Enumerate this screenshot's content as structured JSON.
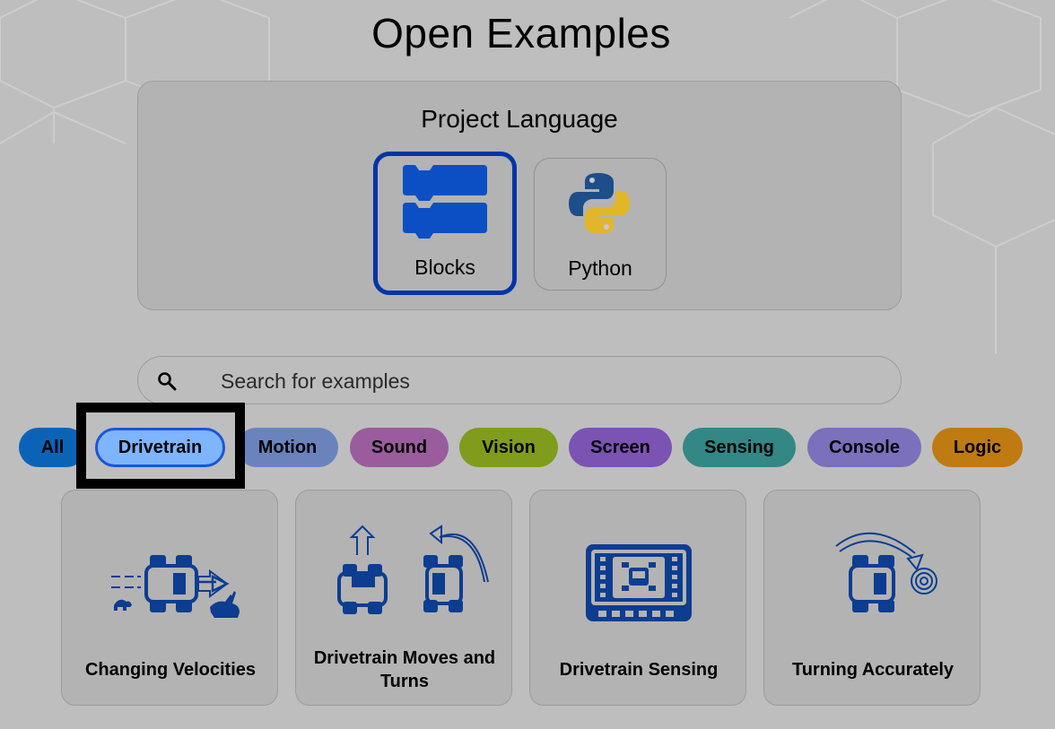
{
  "page_title": "Open Examples",
  "language": {
    "title": "Project Language",
    "options": [
      {
        "label": "Blocks",
        "selected": true,
        "icon": "blocks-icon"
      },
      {
        "label": "Python",
        "selected": false,
        "icon": "python-icon"
      }
    ]
  },
  "search": {
    "placeholder": "Search for examples",
    "value": "",
    "icon": "search-icon"
  },
  "categories": [
    {
      "label": "All",
      "color": "#0b63b8"
    },
    {
      "label": "Drivetrain",
      "color": "#7fb4ff",
      "selected": true
    },
    {
      "label": "Motion",
      "color": "#6a83bd"
    },
    {
      "label": "Sound",
      "color": "#9a5c9d"
    },
    {
      "label": "Vision",
      "color": "#7f9c1c"
    },
    {
      "label": "Screen",
      "color": "#7b53b3"
    },
    {
      "label": "Sensing",
      "color": "#338785"
    },
    {
      "label": "Console",
      "color": "#7a70bb"
    },
    {
      "label": "Logic",
      "color": "#c07a12"
    }
  ],
  "examples": [
    {
      "title": "Changing Velocities",
      "icon": "changing-velocities-icon"
    },
    {
      "title": "Drivetrain Moves and Turns",
      "icon": "moves-and-turns-icon"
    },
    {
      "title": "Drivetrain Sensing",
      "icon": "drivetrain-sensing-icon"
    },
    {
      "title": "Turning Accurately",
      "icon": "turning-accurately-icon"
    }
  ],
  "colors": {
    "accent_blue": "#0035a6",
    "icon_blue": "#0c3d91",
    "background": "#bebebe"
  }
}
